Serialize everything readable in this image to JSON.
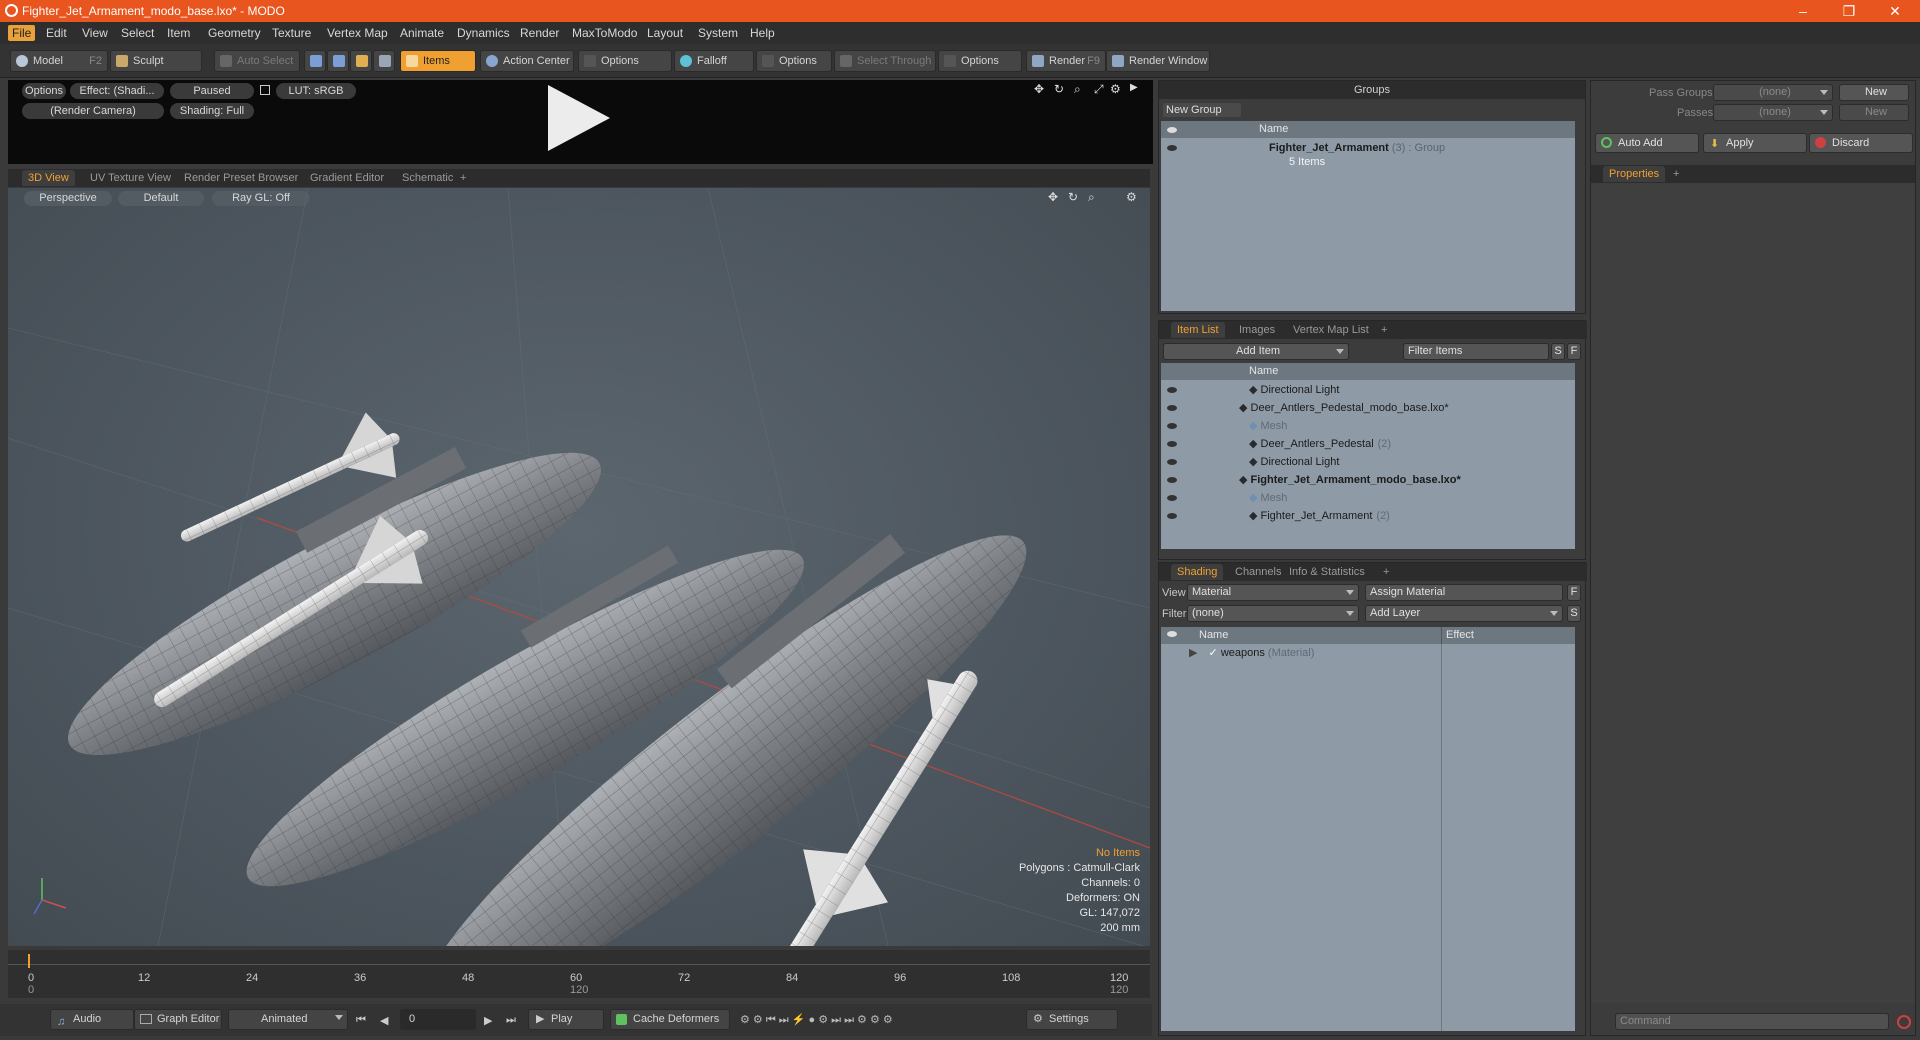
{
  "window": {
    "title": "Fighter_Jet_Armament_modo_base.lxo* - MODO",
    "minimize": "–",
    "restore": "❐",
    "close": "✕"
  },
  "menu": [
    "File",
    "Edit",
    "View",
    "Select",
    "Item",
    "Geometry",
    "Texture",
    "Vertex Map",
    "Animate",
    "Dynamics",
    "Render",
    "MaxToModo",
    "Layout",
    "System",
    "Help"
  ],
  "toolbar": {
    "model": "Model",
    "model_key": "F2",
    "sculpt": "Sculpt",
    "auto_select": "Auto Select",
    "items": "Items",
    "action_center": "Action Center",
    "options1": "Options",
    "falloff": "Falloff",
    "options2": "Options",
    "select_through": "Select Through",
    "options3": "Options",
    "render": "Render",
    "render_key": "F9",
    "render_window": "Render Window"
  },
  "preview": {
    "options": "Options",
    "effect": "Effect: (Shadi...",
    "paused": "Paused",
    "lut": "LUT: sRGB",
    "camera": "(Render Camera)",
    "shading": "Shading: Full"
  },
  "viewport_tabs": [
    "3D View",
    "UV Texture View",
    "Render Preset Browser",
    "Gradient Editor",
    "Schematic",
    "+"
  ],
  "viewport": {
    "perspective": "Perspective",
    "default": "Default",
    "raygl": "Ray GL: Off",
    "stats": {
      "items": "No Items",
      "polygons": "Polygons : Catmull-Clark",
      "channels": "Channels: 0",
      "deformers": "Deformers: ON",
      "gl": "GL: 147,072",
      "scale": "200 mm"
    }
  },
  "timeline": {
    "ticks": [
      "0",
      "12",
      "24",
      "36",
      "48",
      "60",
      "72",
      "84",
      "96",
      "108",
      "120"
    ],
    "sub_start": "0",
    "sub_mid": "120",
    "sub_end": "120"
  },
  "bottombar": {
    "audio": "Audio",
    "graph_editor": "Graph Editor",
    "animated": "Animated",
    "frame": "0",
    "play": "Play",
    "cache_deformers": "Cache Deformers",
    "settings": "Settings"
  },
  "groups": {
    "header": "Groups",
    "new_group": "New Group",
    "col_name": "Name",
    "item_name": "Fighter_Jet_Armament",
    "item_count": "(3)",
    "item_type": ": Group",
    "item_sub": "5 Items"
  },
  "passes": {
    "pass_groups": "Pass Groups",
    "passes": "Passes",
    "none1": "(none)",
    "none2": "(none)",
    "new1": "New",
    "new2": "New",
    "auto_add": "Auto Add",
    "apply": "Apply",
    "discard": "Discard",
    "properties": "Properties",
    "plus": "+"
  },
  "itemlist": {
    "tabs": [
      "Item List",
      "Images",
      "Vertex Map List",
      "+"
    ],
    "add_item": "Add Item",
    "filter": "Filter Items",
    "s": "S",
    "f": "F",
    "col_name": "Name",
    "rows": [
      {
        "label": "Directional Light",
        "extra": "",
        "indent": 90,
        "dim": false,
        "bold": false
      },
      {
        "label": "Deer_Antlers_Pedestal_modo_base.lxo*",
        "extra": "",
        "indent": 80,
        "dim": false,
        "bold": false
      },
      {
        "label": "Mesh",
        "extra": "",
        "indent": 90,
        "dim": true,
        "bold": false
      },
      {
        "label": "Deer_Antlers_Pedestal",
        "extra": "(2)",
        "indent": 90,
        "dim": false,
        "bold": false
      },
      {
        "label": "Directional Light",
        "extra": "",
        "indent": 90,
        "dim": false,
        "bold": false
      },
      {
        "label": "Fighter_Jet_Armament_modo_base.lxo*",
        "extra": "",
        "indent": 80,
        "dim": false,
        "bold": true
      },
      {
        "label": "Mesh",
        "extra": "",
        "indent": 90,
        "dim": true,
        "bold": false
      },
      {
        "label": "Fighter_Jet_Armament",
        "extra": "(2)",
        "indent": 90,
        "dim": false,
        "bold": false
      }
    ]
  },
  "shading": {
    "tabs": [
      "Shading",
      "Channels",
      "Info & Statistics",
      "+"
    ],
    "view_label": "View",
    "view_value": "Material",
    "assign": "Assign Material",
    "filter_label": "Filter",
    "filter_value": "(none)",
    "add_layer": "Add Layer",
    "f": "F",
    "s": "S",
    "col_name": "Name",
    "col_effect": "Effect",
    "row_name": "weapons",
    "row_type": "(Material)"
  },
  "command": {
    "placeholder": "Command"
  }
}
